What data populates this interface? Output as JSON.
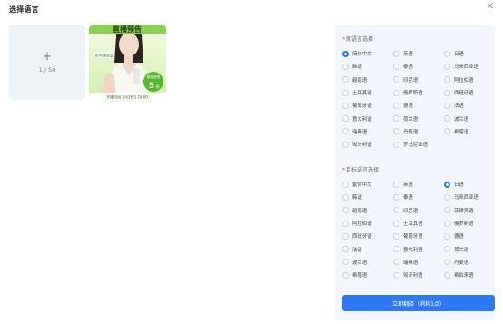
{
  "dialog": {
    "title": "选择语言",
    "close_icon": "close-icon"
  },
  "upload": {
    "plus": "+",
    "count": "1 / 50"
  },
  "thumbnail": {
    "headline": "直播预告",
    "badge": "好利锦夜会",
    "promo_top": "精品好物",
    "promo_big": "5",
    "promo_unit": "折",
    "footer": "开播时间  3月26日 19:00"
  },
  "source": {
    "label": "原语言选择",
    "options": [
      "简体中文",
      "英语",
      "日语",
      "韩语",
      "泰语",
      "马来西亚语",
      "越南语",
      "印尼语",
      "阿拉伯语",
      "土耳其语",
      "俄罗斯语",
      "西班牙语",
      "葡萄牙语",
      "德语",
      "法语",
      "意大利语",
      "荷兰语",
      "波兰语",
      "瑞典语",
      "丹麦语",
      "希腊语",
      "匈牙利语",
      "罗马尼亚语"
    ],
    "selected": 0
  },
  "target": {
    "label": "目标语言选择",
    "options": [
      "繁体中文",
      "英语",
      "日语",
      "韩语",
      "泰语",
      "马来西亚语",
      "越南语",
      "印尼语",
      "菲律宾语",
      "阿拉伯语",
      "土耳其语",
      "俄罗斯语",
      "西班牙语",
      "葡萄牙语",
      "德语",
      "法语",
      "意大利语",
      "荷兰语",
      "波兰语",
      "瑞典语",
      "丹麦语",
      "希腊语",
      "匈牙利语",
      "希伯来语"
    ],
    "selected": 2
  },
  "submit_label": "立即翻译（消耗1点）",
  "colors": {
    "accent": "#2f78f4",
    "panel": "#f2f6fc",
    "required": "#e54848"
  }
}
